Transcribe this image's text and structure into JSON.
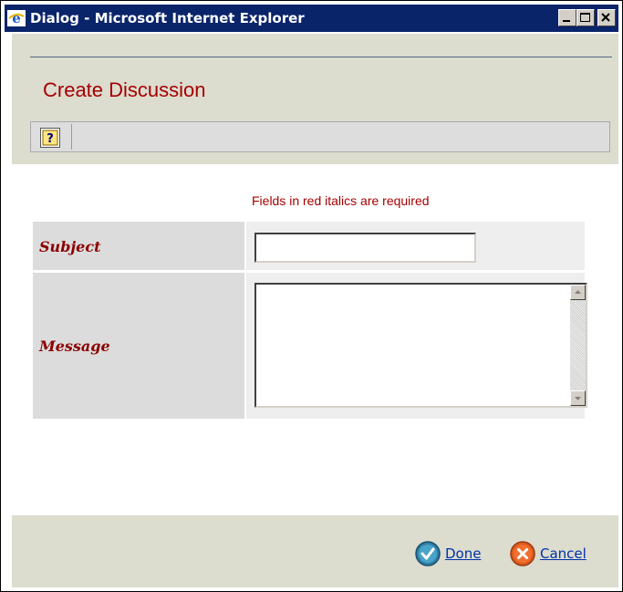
{
  "window": {
    "title": "Dialog - Microsoft Internet Explorer"
  },
  "header": {
    "title": "Create Discussion",
    "toolbar": {
      "help_glyph": "?"
    }
  },
  "form": {
    "required_note": "Fields in red italics are required",
    "subject": {
      "label": "Subject",
      "value": ""
    },
    "message": {
      "label": "Message",
      "value": ""
    }
  },
  "footer": {
    "done_label": "Done",
    "cancel_label": "Cancel"
  },
  "colors": {
    "titlebar": "#0a246a",
    "accent_red": "#a50000",
    "panel_beige": "#dcdccf",
    "link_blue": "#0033aa"
  },
  "icons": [
    "ie-icon",
    "minimize-icon",
    "maximize-icon",
    "close-icon",
    "help-icon",
    "check-icon",
    "cancel-x-icon",
    "scroll-up-icon",
    "scroll-down-icon"
  ]
}
